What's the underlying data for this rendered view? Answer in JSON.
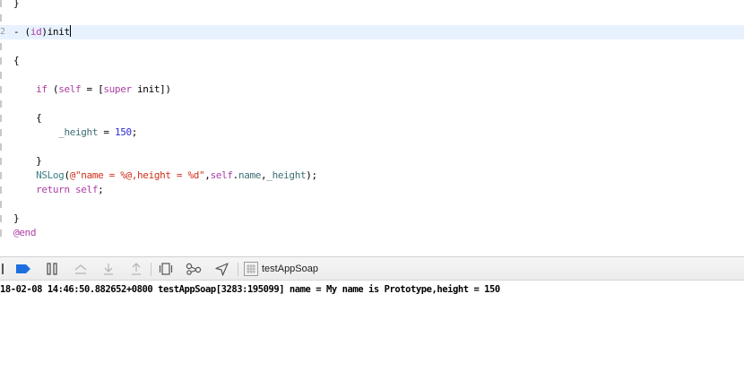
{
  "editor": {
    "lines": [
      {
        "tokens": [
          {
            "t": "}",
            "c": "plain"
          }
        ]
      },
      {
        "blank": true
      },
      {
        "current": true,
        "gutter_num": "2",
        "caret": true,
        "tokens": [
          {
            "t": "- (",
            "c": "plain"
          },
          {
            "t": "id",
            "c": "keyword"
          },
          {
            "t": ")init",
            "c": "plain"
          }
        ]
      },
      {
        "blank": true
      },
      {
        "tokens": [
          {
            "t": "{",
            "c": "plain"
          }
        ]
      },
      {
        "blank": true
      },
      {
        "tokens": [
          {
            "t": "    ",
            "c": "plain"
          },
          {
            "t": "if",
            "c": "keyword"
          },
          {
            "t": " (",
            "c": "plain"
          },
          {
            "t": "self",
            "c": "keyword"
          },
          {
            "t": " = [",
            "c": "plain"
          },
          {
            "t": "super",
            "c": "keyword"
          },
          {
            "t": " init])",
            "c": "plain"
          }
        ]
      },
      {
        "blank": true
      },
      {
        "tokens": [
          {
            "t": "    {",
            "c": "plain"
          }
        ]
      },
      {
        "tokens": [
          {
            "t": "        ",
            "c": "plain"
          },
          {
            "t": "_height",
            "c": "ivar"
          },
          {
            "t": " = ",
            "c": "plain"
          },
          {
            "t": "150",
            "c": "num"
          },
          {
            "t": ";",
            "c": "plain"
          }
        ]
      },
      {
        "blank": true
      },
      {
        "tokens": [
          {
            "t": "    }",
            "c": "plain"
          }
        ]
      },
      {
        "tokens": [
          {
            "t": "    ",
            "c": "plain"
          },
          {
            "t": "NSLog",
            "c": "fn"
          },
          {
            "t": "(",
            "c": "plain"
          },
          {
            "t": "@\"name = %@,height = %d\"",
            "c": "string"
          },
          {
            "t": ",",
            "c": "plain"
          },
          {
            "t": "self",
            "c": "keyword"
          },
          {
            "t": ".",
            "c": "plain"
          },
          {
            "t": "name",
            "c": "prop"
          },
          {
            "t": ",",
            "c": "plain"
          },
          {
            "t": "_height",
            "c": "ivar"
          },
          {
            "t": ");",
            "c": "plain"
          }
        ]
      },
      {
        "tokens": [
          {
            "t": "    ",
            "c": "plain"
          },
          {
            "t": "return",
            "c": "keyword"
          },
          {
            "t": " ",
            "c": "plain"
          },
          {
            "t": "self",
            "c": "keyword"
          },
          {
            "t": ";",
            "c": "plain"
          }
        ]
      },
      {
        "blank": true
      },
      {
        "tokens": [
          {
            "t": "}",
            "c": "plain"
          }
        ]
      },
      {
        "tokens": [
          {
            "t": "@end",
            "c": "keyword"
          }
        ]
      }
    ]
  },
  "debug_bar": {
    "icons": {
      "breakpoints_toggle": "breakpoint-toggle-icon",
      "pause": "pause-icon",
      "step_over": "step-over-icon",
      "step_into": "step-into-icon",
      "step_out": "step-out-icon",
      "view_debugger": "view-hierarchy-icon",
      "memory_graph": "memory-graph-icon",
      "simulate_location": "location-arrow-icon",
      "target": "app-target-icon"
    },
    "target_name": "testAppSoap",
    "accent_color": "#1d6fe0"
  },
  "console": {
    "output": "18-02-08 14:46:50.882652+0800 testAppSoap[3283:195099] name = My name is Prototype,height = 150"
  }
}
